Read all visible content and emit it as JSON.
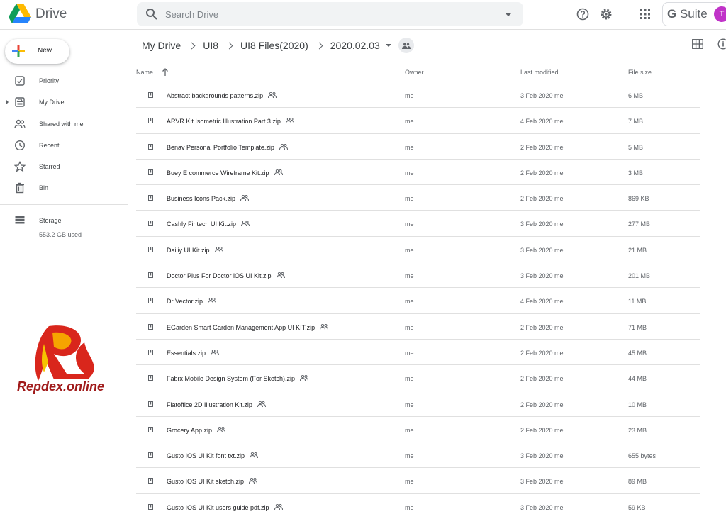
{
  "app": {
    "name": "Drive"
  },
  "search": {
    "placeholder": "Search Drive"
  },
  "header": {
    "gsuite_label": "Suite",
    "gsuite_g": "G",
    "avatar_initial": "T"
  },
  "sidebar": {
    "new_label": "New",
    "items": [
      {
        "label": "Priority",
        "icon": "priority-icon"
      },
      {
        "label": "My Drive",
        "icon": "my-drive-icon"
      },
      {
        "label": "Shared with me",
        "icon": "shared-with-me-icon"
      },
      {
        "label": "Recent",
        "icon": "recent-icon"
      },
      {
        "label": "Starred",
        "icon": "star-icon"
      },
      {
        "label": "Bin",
        "icon": "bin-icon"
      }
    ],
    "storage": {
      "label": "Storage",
      "used": "553.2 GB used"
    }
  },
  "watermark": {
    "text": "Repdex.online"
  },
  "breadcrumb": [
    "My Drive",
    "UI8",
    "UI8 Files(2020)",
    "2020.02.03"
  ],
  "table": {
    "columns": {
      "name": "Name",
      "owner": "Owner",
      "modified": "Last modified",
      "size": "File size"
    },
    "rows": [
      {
        "name": "Abstract backgrounds patterns.zip",
        "owner": "me",
        "modified": "3 Feb 2020 me",
        "size": "6 MB"
      },
      {
        "name": "ARVR Kit Isometric Illustration Part 3.zip",
        "owner": "me",
        "modified": "4 Feb 2020 me",
        "size": "7 MB"
      },
      {
        "name": "Benav Personal Portfolio Template.zip",
        "owner": "me",
        "modified": "2 Feb 2020 me",
        "size": "5 MB"
      },
      {
        "name": "Buey E commerce Wireframe Kit.zip",
        "owner": "me",
        "modified": "2 Feb 2020 me",
        "size": "3 MB"
      },
      {
        "name": "Business Icons Pack.zip",
        "owner": "me",
        "modified": "2 Feb 2020 me",
        "size": "869 KB"
      },
      {
        "name": "Cashly Fintech UI Kit.zip",
        "owner": "me",
        "modified": "3 Feb 2020 me",
        "size": "277 MB"
      },
      {
        "name": "Dailiy UI Kit.zip",
        "owner": "me",
        "modified": "3 Feb 2020 me",
        "size": "21 MB"
      },
      {
        "name": "Doctor Plus For Doctor iOS UI Kit.zip",
        "owner": "me",
        "modified": "3 Feb 2020 me",
        "size": "201 MB"
      },
      {
        "name": "Dr Vector.zip",
        "owner": "me",
        "modified": "4 Feb 2020 me",
        "size": "11 MB"
      },
      {
        "name": "EGarden Smart Garden Management App UI KIT.zip",
        "owner": "me",
        "modified": "2 Feb 2020 me",
        "size": "71 MB"
      },
      {
        "name": "Essentials.zip",
        "owner": "me",
        "modified": "2 Feb 2020 me",
        "size": "45 MB"
      },
      {
        "name": "Fabrx Mobile Design System (For Sketch).zip",
        "owner": "me",
        "modified": "2 Feb 2020 me",
        "size": "44 MB"
      },
      {
        "name": "Flatoffice 2D Illustration Kit.zip",
        "owner": "me",
        "modified": "2 Feb 2020 me",
        "size": "10 MB"
      },
      {
        "name": "Grocery App.zip",
        "owner": "me",
        "modified": "2 Feb 2020 me",
        "size": "23 MB"
      },
      {
        "name": "Gusto IOS UI Kit font txt.zip",
        "owner": "me",
        "modified": "3 Feb 2020 me",
        "size": "655 bytes"
      },
      {
        "name": "Gusto IOS UI Kit sketch.zip",
        "owner": "me",
        "modified": "3 Feb 2020 me",
        "size": "89 MB"
      },
      {
        "name": "Gusto IOS UI Kit users guide pdf.zip",
        "owner": "me",
        "modified": "3 Feb 2020 me",
        "size": "59 KB"
      }
    ]
  }
}
